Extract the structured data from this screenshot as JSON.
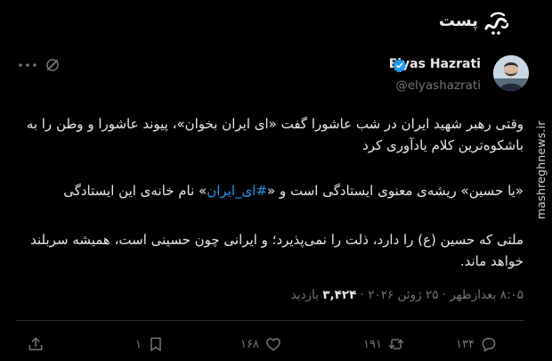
{
  "header": {
    "title": "پست"
  },
  "watermark": {
    "site": "mashreghnews.ir"
  },
  "author": {
    "name": "Elyas Hazrati",
    "handle": "@elyashazrati"
  },
  "post": {
    "paragraph1": "وقتی رهبر شهید ایران در شب عاشورا گفت «ای ایران بخوان»، پیوند عاشورا و وطن را به باشکوه‌ترین کلام یادآوری کرد",
    "paragraph2_before": "«یا حسین» ریشه‌ی معنوی ایستادگی است و «",
    "paragraph2_hashtag": "#ای_ایران",
    "paragraph2_after": "» نام خانه‌ی این ایستادگی",
    "paragraph3": "ملتی که حسین (ع) را دارد، ذلت را نمی‌پذیرد؛ و ایرانی چون حسینی است، همیشه سربلند خواهد ماند."
  },
  "meta": {
    "time": "۸:۰۵ بعدازظهر",
    "separator": "·",
    "date": "۲۵ ژوئن ۲۰۲۶",
    "views": "۳,۴۲۴",
    "views_label": "بازدید"
  },
  "actions": {
    "replies": "۱۳۴",
    "reposts": "۱۹۱",
    "likes": "۱۶۸",
    "bookmarks": "۱"
  },
  "colors": {
    "background": "#000000",
    "text": "#e7e9ea",
    "muted": "#71767b",
    "accent": "#1d9bf0",
    "divider": "#2f3336"
  },
  "icons": [
    "logo-icon",
    "verified-icon",
    "more-icon",
    "grok-icon",
    "reply-icon",
    "repost-icon",
    "like-icon",
    "bookmark-icon",
    "share-icon"
  ]
}
